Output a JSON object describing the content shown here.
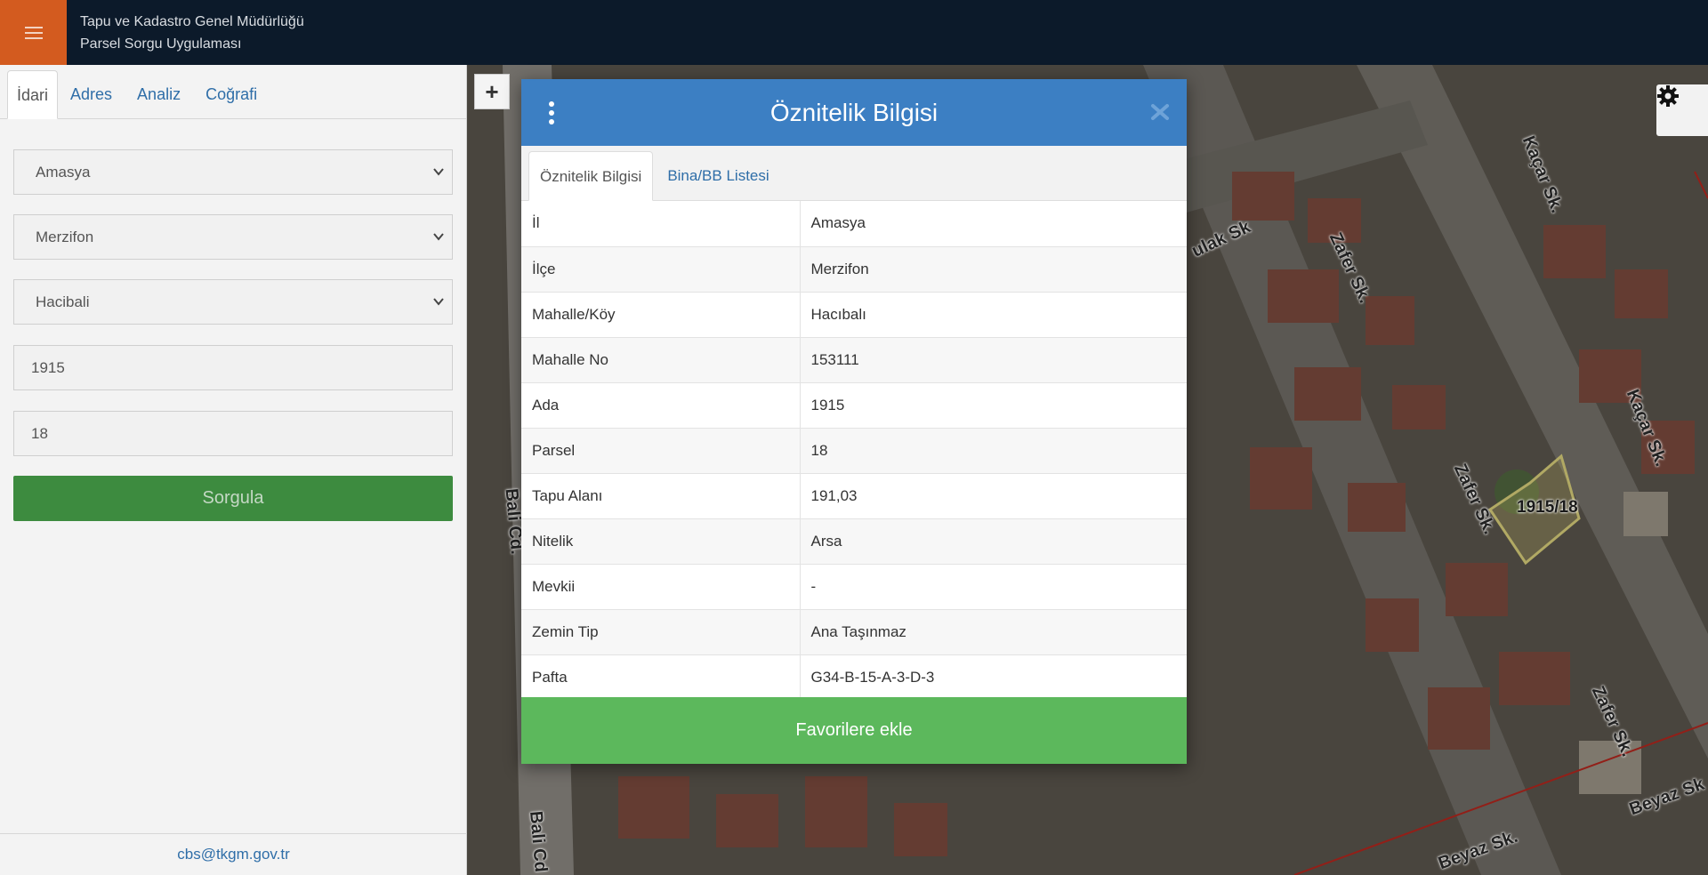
{
  "header": {
    "line1": "Tapu ve Kadastro Genel Müdürlüğü",
    "line2": "Parsel Sorgu Uygulaması"
  },
  "sidebar": {
    "tabs": [
      {
        "label": "İdari"
      },
      {
        "label": "Adres"
      },
      {
        "label": "Analiz"
      },
      {
        "label": "Coğrafi"
      }
    ],
    "il": "Amasya",
    "ilce": "Merzifon",
    "mahalle": "Hacibali",
    "ada": "1915",
    "parsel": "18",
    "sorgula_label": "Sorgula",
    "footer_email": "cbs@tkgm.gov.tr"
  },
  "map": {
    "zoom_in_label": "+",
    "parcel_label": "1915/18",
    "streets": [
      "Kaçar Sk.",
      "Kaçar Sk.",
      "Zafer Sk.",
      "Zafer Sk.",
      "Zafer Sk.",
      "Beyaz Sk.",
      "Beyaz Sk",
      "Bali Cd.",
      "Bali Cd",
      "ulak Sk"
    ]
  },
  "modal": {
    "title": "Öznitelik Bilgisi",
    "tabs": [
      {
        "label": "Öznitelik Bilgisi"
      },
      {
        "label": "Bina/BB Listesi"
      }
    ],
    "rows": [
      {
        "key": "İl",
        "value": "Amasya"
      },
      {
        "key": "İlçe",
        "value": "Merzifon"
      },
      {
        "key": "Mahalle/Köy",
        "value": "Hacıbalı"
      },
      {
        "key": "Mahalle No",
        "value": "153111"
      },
      {
        "key": "Ada",
        "value": "1915"
      },
      {
        "key": "Parsel",
        "value": "18"
      },
      {
        "key": "Tapu Alanı",
        "value": "191,03"
      },
      {
        "key": "Nitelik",
        "value": "Arsa"
      },
      {
        "key": "Mevkii",
        "value": "-"
      },
      {
        "key": "Zemin Tip",
        "value": "Ana Taşınmaz"
      },
      {
        "key": "Pafta",
        "value": "G34-B-15-A-3-D-3"
      }
    ],
    "favorite_label": "Favorilere ekle"
  },
  "colors": {
    "header_bg": "#0c1a2a",
    "menu_accent": "#d35b1f",
    "modal_header": "#3c7fc3",
    "favorite_green": "#5cb85c",
    "sorgula_green": "#3d8b3f",
    "link_blue": "#2f6ea8"
  }
}
